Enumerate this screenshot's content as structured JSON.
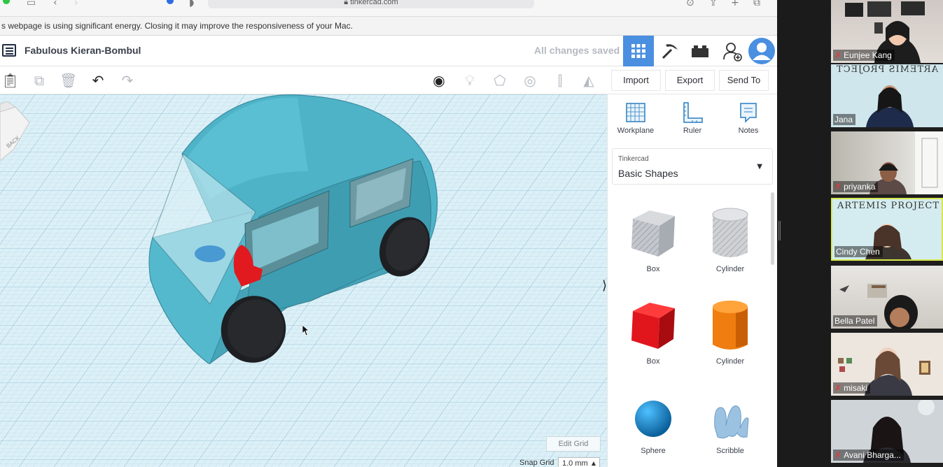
{
  "browser": {
    "url": "tinkercad.com",
    "energy_warning": "s webpage is using significant energy. Closing it may improve the responsiveness of your Mac."
  },
  "header": {
    "design_title": "Fabulous Kieran-Bombul",
    "save_status": "All changes saved"
  },
  "toolbar": {
    "import_label": "Import",
    "export_label": "Export",
    "send_to_label": "Send To"
  },
  "panel": {
    "tools": [
      {
        "label": "Workplane",
        "icon": "workplane-icon"
      },
      {
        "label": "Ruler",
        "icon": "ruler-icon"
      },
      {
        "label": "Notes",
        "icon": "notes-icon"
      }
    ],
    "library_source": "Tinkercad",
    "library_name": "Basic Shapes",
    "shapes": [
      {
        "label": "Box",
        "color": "#b9bcc2"
      },
      {
        "label": "Cylinder",
        "color": "#c9cbcf"
      },
      {
        "label": "Box",
        "color": "#e0161c"
      },
      {
        "label": "Cylinder",
        "color": "#f07d0f"
      },
      {
        "label": "Sphere",
        "color": "#1a8fd0"
      },
      {
        "label": "Scribble",
        "color": "#8ab4d9"
      }
    ]
  },
  "viewport": {
    "viewcube_face": "BACK",
    "edit_grid_label": "Edit Grid",
    "snap_grid_label": "Snap Grid",
    "snap_grid_value": "1.0 mm"
  },
  "participants": [
    {
      "name": "Eunjee Kang",
      "muted": true
    },
    {
      "name": "Jana",
      "muted": false,
      "banner": "ARTEMIS PROJECT",
      "banner_mirrored": true
    },
    {
      "name": "priyanka",
      "muted": true
    },
    {
      "name": "Cindy Chen",
      "muted": false,
      "banner": "ARTEMIS PROJECT",
      "active_speaker": true
    },
    {
      "name": "Bella Patel",
      "muted": false
    },
    {
      "name": "misaki",
      "muted": true
    },
    {
      "name": "Avani Bharga...",
      "muted": true
    }
  ],
  "colors": {
    "accent": "#4a8fe0",
    "car_body": "#4fb3c8",
    "active_speaker_border": "#d8e84a",
    "mic_muted": "#e23b3b"
  }
}
